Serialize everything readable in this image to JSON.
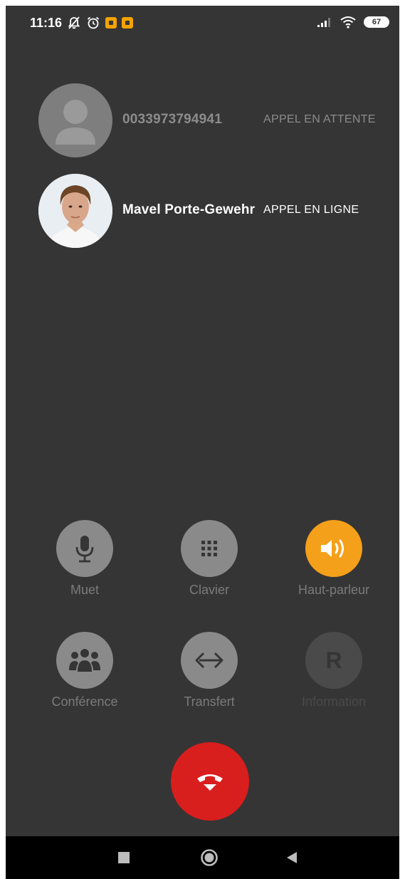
{
  "status_bar": {
    "time": "11:16",
    "battery": "67"
  },
  "calls": [
    {
      "name": "0033973794941",
      "status": "APPEL EN ATTENTE"
    },
    {
      "name": "Mavel Porte-Gewehr",
      "status": "APPEL EN LIGNE"
    }
  ],
  "actions": {
    "mute": "Muet",
    "keypad": "Clavier",
    "speaker": "Haut-parleur",
    "conference": "Conférence",
    "transfer": "Transfert",
    "information": "Information"
  },
  "colors": {
    "background": "#353535",
    "speaker_active": "#f5a01a",
    "hangup": "#d91e1e"
  }
}
